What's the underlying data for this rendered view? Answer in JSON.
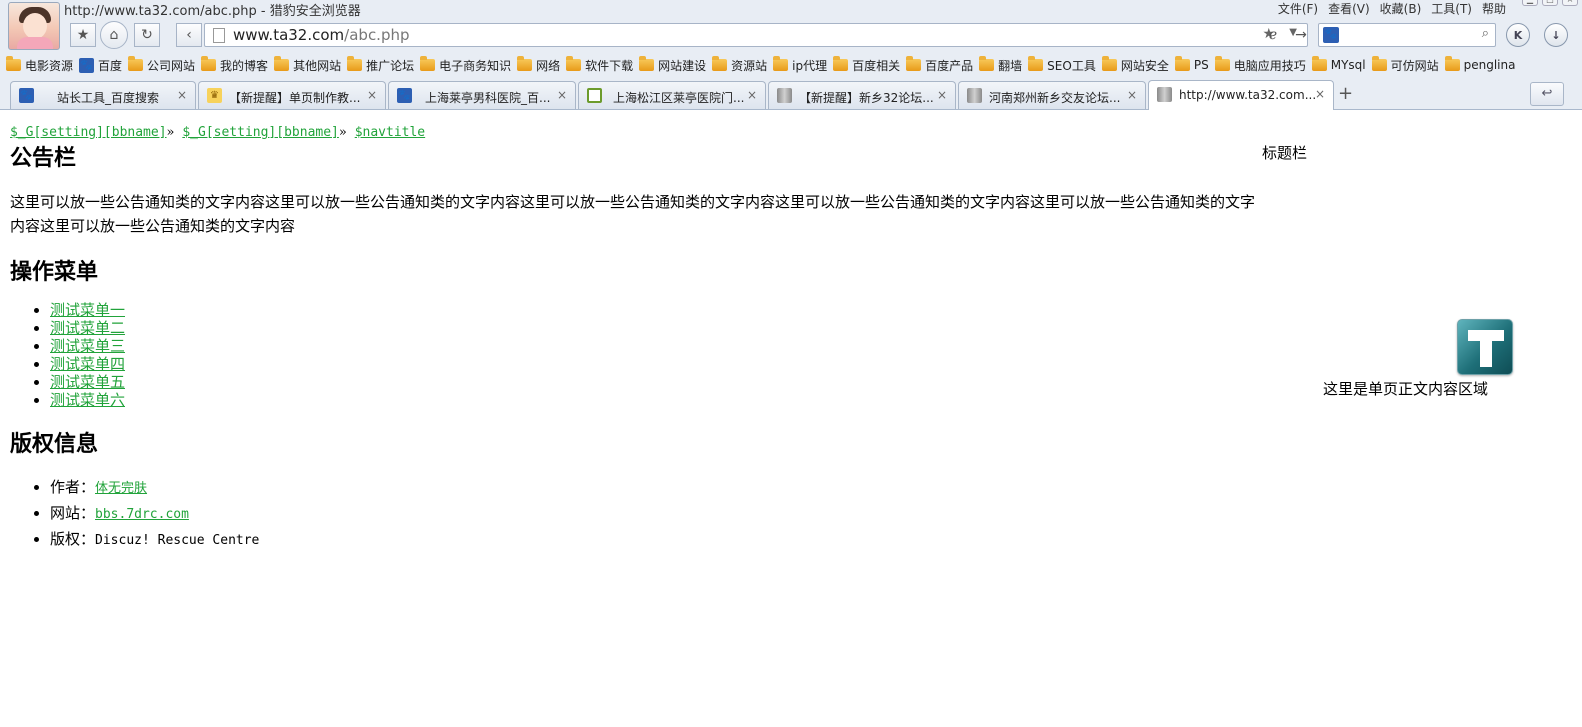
{
  "window": {
    "title": "http://www.ta32.com/abc.php - 猎豹安全浏览器",
    "menu": [
      "文件(F)",
      "查看(V)",
      "收藏(B)",
      "工具(T)",
      "帮助"
    ]
  },
  "navbar": {
    "url_host": "www.ta32.com",
    "url_path": "/abc.php",
    "back_icon": "back-icon",
    "home_icon": "home-icon",
    "refresh_icon": "refresh-icon",
    "search_engine_icon": "baidu-paw-icon",
    "circle_k_label": "K"
  },
  "bookmarks": [
    {
      "label": "电影资源",
      "icon": "folder"
    },
    {
      "label": "百度",
      "icon": "paw"
    },
    {
      "label": "公司网站",
      "icon": "folder"
    },
    {
      "label": "我的博客",
      "icon": "folder"
    },
    {
      "label": "其他网站",
      "icon": "folder"
    },
    {
      "label": "推广论坛",
      "icon": "folder"
    },
    {
      "label": "电子商务知识",
      "icon": "folder"
    },
    {
      "label": "网络",
      "icon": "folder"
    },
    {
      "label": "软件下载",
      "icon": "folder"
    },
    {
      "label": "网站建设",
      "icon": "folder"
    },
    {
      "label": "资源站",
      "icon": "folder"
    },
    {
      "label": "ip代理",
      "icon": "folder"
    },
    {
      "label": "百度相关",
      "icon": "folder"
    },
    {
      "label": "百度产品",
      "icon": "folder"
    },
    {
      "label": "翻墙",
      "icon": "folder"
    },
    {
      "label": "SEO工具",
      "icon": "folder"
    },
    {
      "label": "网站安全",
      "icon": "folder"
    },
    {
      "label": "PS",
      "icon": "folder"
    },
    {
      "label": "电脑应用技巧",
      "icon": "folder"
    },
    {
      "label": "MYsql",
      "icon": "folder"
    },
    {
      "label": "可仿网站",
      "icon": "folder"
    },
    {
      "label": "penglina",
      "icon": "folder"
    }
  ],
  "tabs": [
    {
      "label": "站长工具_百度搜索",
      "icon": "paw"
    },
    {
      "label": "【新提醒】单页制作教...",
      "icon": "cup"
    },
    {
      "label": "上海莱亭男科医院_百...",
      "icon": "paw"
    },
    {
      "label": "上海松江区莱亭医院门...",
      "icon": "hex"
    },
    {
      "label": "【新提醒】新乡32论坛...",
      "icon": "building"
    },
    {
      "label": "河南郑州新乡交友论坛...",
      "icon": "building"
    },
    {
      "label": "http://www.ta32.com...",
      "icon": "building"
    }
  ],
  "page": {
    "breadcrumb": [
      "$_G[setting][bbname]",
      "$_G[setting][bbname]",
      "$navtitle"
    ],
    "breadcrumb_sep": "»",
    "notice_heading": "公告栏",
    "notice_text": "这里可以放一些公告通知类的文字内容这里可以放一些公告通知类的文字内容这里可以放一些公告通知类的文字内容这里可以放一些公告通知类的文字内容这里可以放一些公告通知类的文字内容这里可以放一些公告通知类的文字内容",
    "menu_heading": "操作菜单",
    "menu_items": [
      "测试菜单一",
      "测试菜单二",
      "测试菜单三",
      "测试菜单四",
      "测试菜单五",
      "测试菜单六"
    ],
    "copyright_heading": "版权信息",
    "author_label": "作者：",
    "author_value": "体无完肤",
    "site_label": "网站：",
    "site_value": "bbs.7drc.com",
    "copy_label": "版权：",
    "copy_value": "Discuz! Rescue Centre",
    "side_title": "标题栏",
    "main_text": "这里是单页正文内容区域",
    "link_color": "#21a33a"
  }
}
